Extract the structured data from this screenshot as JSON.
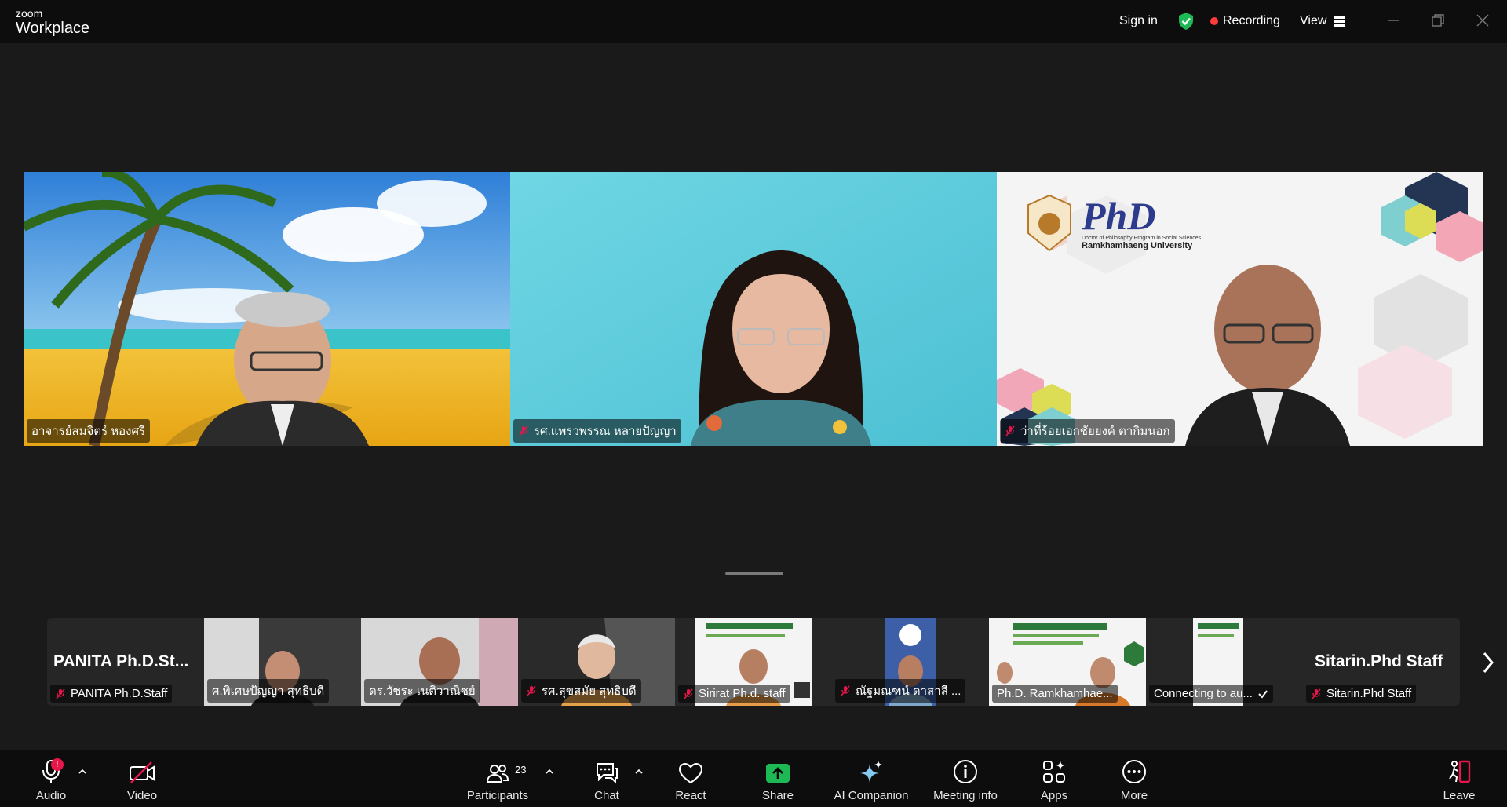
{
  "app": {
    "logo_line1": "zoom",
    "logo_line2": "Workplace"
  },
  "topbar": {
    "sign_in": "Sign in",
    "recording": "Recording",
    "view": "View"
  },
  "speakers": [
    {
      "name": "อาจารย์สมจิตร์ หองศรี",
      "muted": false
    },
    {
      "name": "รศ.แพรวพรรณ  หลายปัญญา",
      "muted": true
    },
    {
      "name": "ว่าที่ร้อยเอกชัยยงค์ ตากิมนอก",
      "muted": true
    }
  ],
  "phd_logo": {
    "title": "PhD",
    "subtitle": "Doctor of Philosophy Program in Social Sciences",
    "university": "Ramkhamhaeng University"
  },
  "thumbnails": [
    {
      "display": "PANITA  Ph.D.St...",
      "name": "PANITA Ph.D.Staff",
      "muted": true
    },
    {
      "name": "ศ.พิเศษปัญญา สุทธิบดี",
      "muted": false
    },
    {
      "name": "ดร.วัชระ เนติวาณิชย์",
      "muted": false
    },
    {
      "name": "รศ.สุขสมัย  สุทธิบดี",
      "muted": true
    },
    {
      "name": "Sirirat Ph.d. staff",
      "muted": true
    },
    {
      "name": "ณัฐมณฑน์ ดาสาลี ...",
      "muted": true
    },
    {
      "name": "Ph.D. Ramkhamhae...",
      "muted": false
    },
    {
      "name": "Connecting to au...",
      "muted": false
    },
    {
      "display": "Sitarin.Phd Staff",
      "name": "Sitarin.Phd Staff",
      "muted": true
    }
  ],
  "toolbar": {
    "audio": "Audio",
    "audio_badge": "!",
    "video": "Video",
    "participants": "Participants",
    "participants_count": "23",
    "chat": "Chat",
    "react": "React",
    "share": "Share",
    "ai_companion": "AI Companion",
    "meeting_info": "Meeting info",
    "apps": "Apps",
    "more": "More",
    "leave": "Leave"
  },
  "colors": {
    "shield": "#1db954",
    "recording_dot": "#ff3b3b",
    "share": "#1db954",
    "leave": "#e8164a",
    "badge": "#e8164a"
  }
}
